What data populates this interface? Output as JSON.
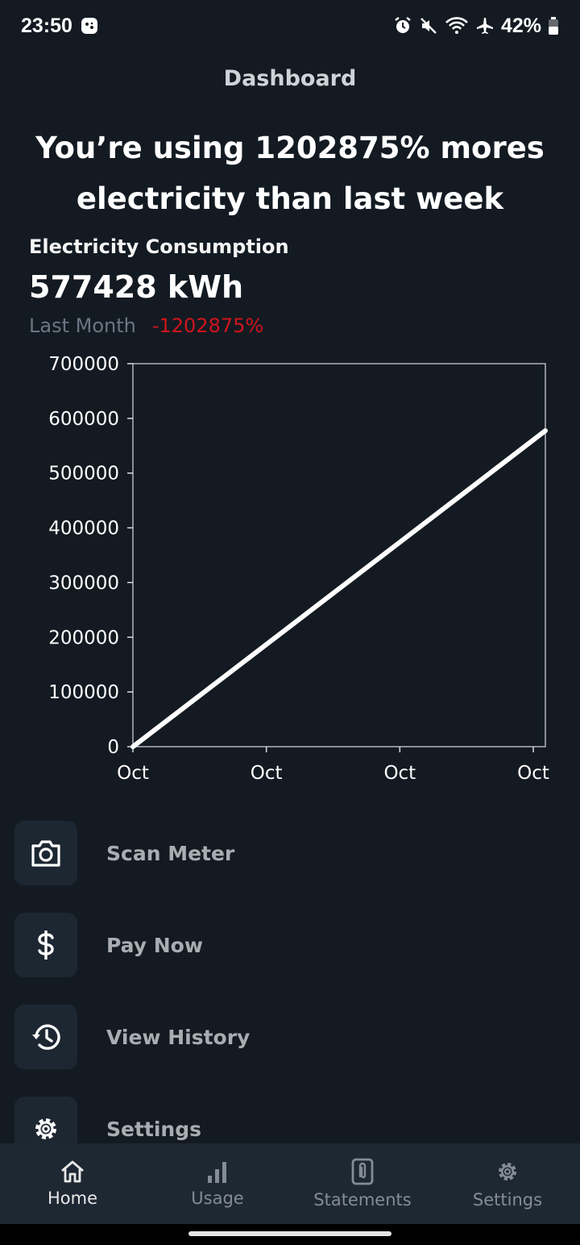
{
  "status_bar": {
    "time": "23:50",
    "battery_percent": "42%",
    "icons": [
      "game-icon",
      "alarm-icon",
      "mute-icon",
      "wifi-icon",
      "airplane-icon",
      "battery-icon"
    ]
  },
  "header": {
    "title": "Dashboard"
  },
  "headline": "You’re using 1202875% mores electricity than last week",
  "metric": {
    "label": "Electricity Consumption",
    "value": "577428 kWh",
    "compare_label": "Last Month",
    "compare_value": "-1202875%"
  },
  "colors": {
    "background": "#131a22",
    "card": "#1d2732",
    "nav_background": "#1e2833",
    "negative": "#d0141d",
    "line": "#ffffff"
  },
  "chart_data": {
    "type": "line",
    "x": [
      "Oct",
      "Oct",
      "Oct",
      "Oct"
    ],
    "series": [
      {
        "values": [
          0,
          577428
        ]
      }
    ],
    "y_ticks": [
      "700000",
      "600000",
      "500000",
      "400000",
      "300000",
      "200000",
      "100000",
      "0"
    ],
    "ylim": [
      0,
      700000
    ],
    "grid": false
  },
  "actions": [
    {
      "label": "Scan Meter",
      "icon": "camera-icon"
    },
    {
      "label": "Pay Now",
      "icon": "dollar-icon"
    },
    {
      "label": "View History",
      "icon": "history-icon"
    },
    {
      "label": "Settings",
      "icon": "gear-icon"
    }
  ],
  "bottom_nav": [
    {
      "label": "Home",
      "icon": "home-icon",
      "active": true
    },
    {
      "label": "Usage",
      "icon": "bar-chart-icon",
      "active": false
    },
    {
      "label": "Statements",
      "icon": "clip-document-icon",
      "active": false
    },
    {
      "label": "Settings",
      "icon": "gear-icon",
      "active": false
    }
  ]
}
